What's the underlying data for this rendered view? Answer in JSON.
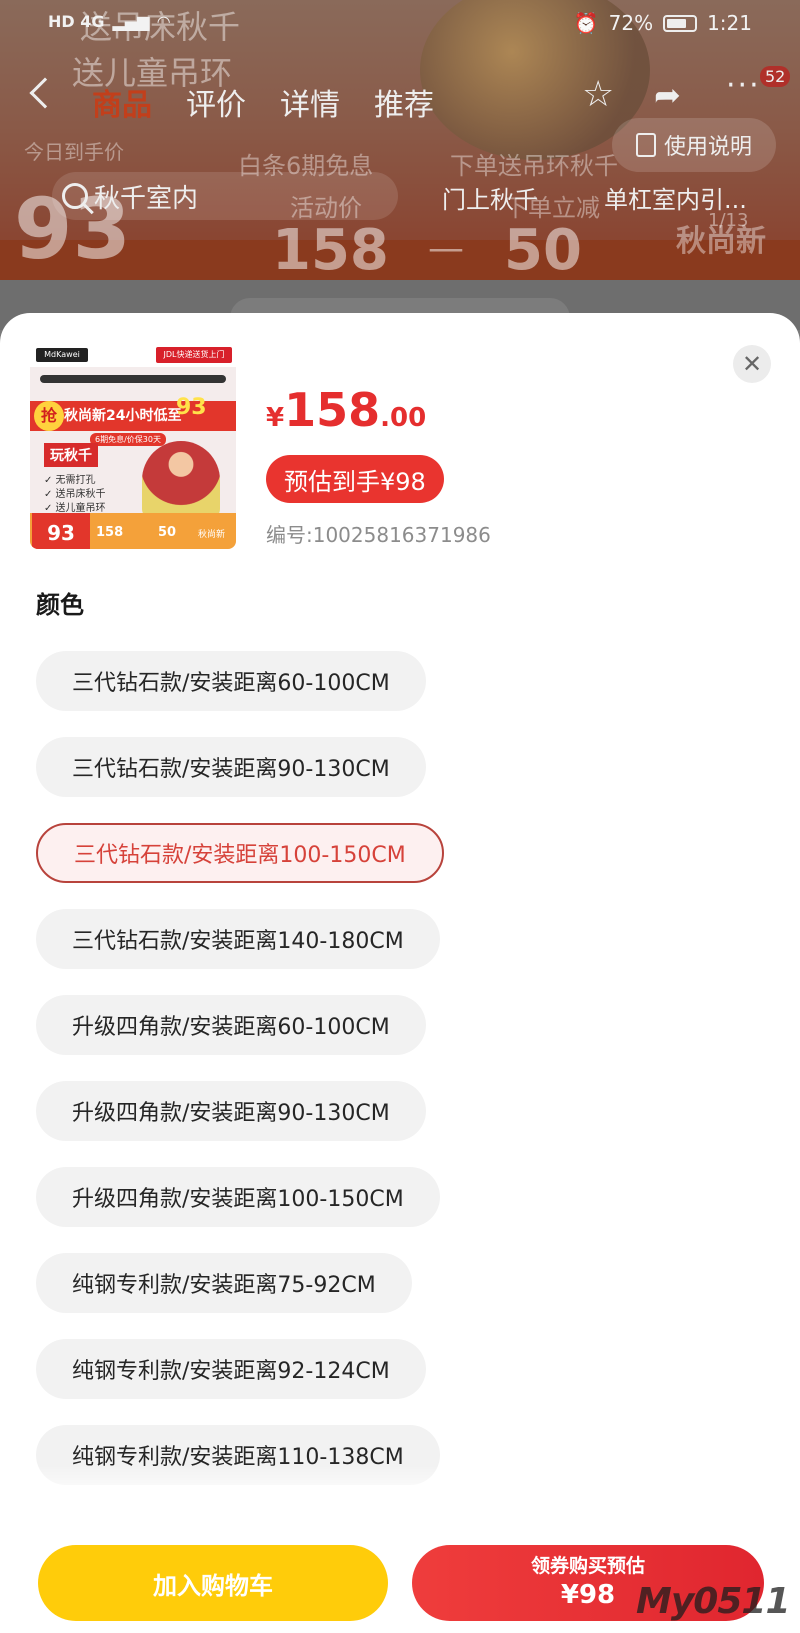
{
  "status_bar": {
    "network": "HD 4G",
    "battery": "72%",
    "battery_level": 0.72,
    "time": "1:21"
  },
  "background": {
    "promo_line1": "送吊床秋千",
    "promo_line2": "送儿童吊环",
    "nav_tabs": [
      "商品",
      "评价",
      "详情",
      "推荐"
    ],
    "active_tab": "商品",
    "cart_badge": "52",
    "today_price_label": "今日到手价",
    "today_price": "93",
    "promo_installment": "白条6期免息",
    "promo_gift": "下单送吊环秋千",
    "activity_label": "活动价",
    "activity_price": "158",
    "discount_label": "下单立减",
    "discount_amount": "50",
    "dash": "—",
    "brand_tag": "秋尚新",
    "image_index": "1/13",
    "search_text": "秋千室内",
    "chip_1": "门上秋千",
    "chip_2": "单杠室内引...",
    "guide_button": "使用说明"
  },
  "sheet": {
    "close_icon": "✕",
    "thumbnail": {
      "logo": "MdKawei",
      "jdl": "JDL快递送货上门",
      "qiang": "抢",
      "banner": "秋尚新24小时低至",
      "big_price": "93",
      "sub": "6期免息/价保30天",
      "title": "玩秋千",
      "features": [
        "✓ 无需打孔",
        "✓ 送吊床秋千",
        "✓ 送儿童吊环"
      ],
      "footer_price": "93",
      "footer_158": "158",
      "footer_50": "50",
      "footer_new": "秋尚新"
    },
    "price_yen": "¥",
    "price_int": "158",
    "price_dec": ".00",
    "estimate": "预估到手¥98",
    "sku_code": "编号:10025816371986",
    "section_title": "颜色",
    "options": [
      {
        "label": "三代钻石款/安装距离60-100CM",
        "selected": false
      },
      {
        "label": "三代钻石款/安装距离90-130CM",
        "selected": false
      },
      {
        "label": "三代钻石款/安装距离100-150CM",
        "selected": true
      },
      {
        "label": "三代钻石款/安装距离140-180CM",
        "selected": false
      },
      {
        "label": "升级四角款/安装距离60-100CM",
        "selected": false
      },
      {
        "label": "升级四角款/安装距离90-130CM",
        "selected": false
      },
      {
        "label": "升级四角款/安装距离100-150CM",
        "selected": false
      },
      {
        "label": "纯钢专利款/安装距离75-92CM",
        "selected": false
      },
      {
        "label": "纯钢专利款/安装距离92-124CM",
        "selected": false
      },
      {
        "label": "纯钢专利款/安装距离110-138CM",
        "selected": false
      }
    ],
    "add_to_cart": "加入购物车",
    "buy_line1": "领券购买预估",
    "buy_line2": "¥98"
  },
  "watermark": "My0511"
}
